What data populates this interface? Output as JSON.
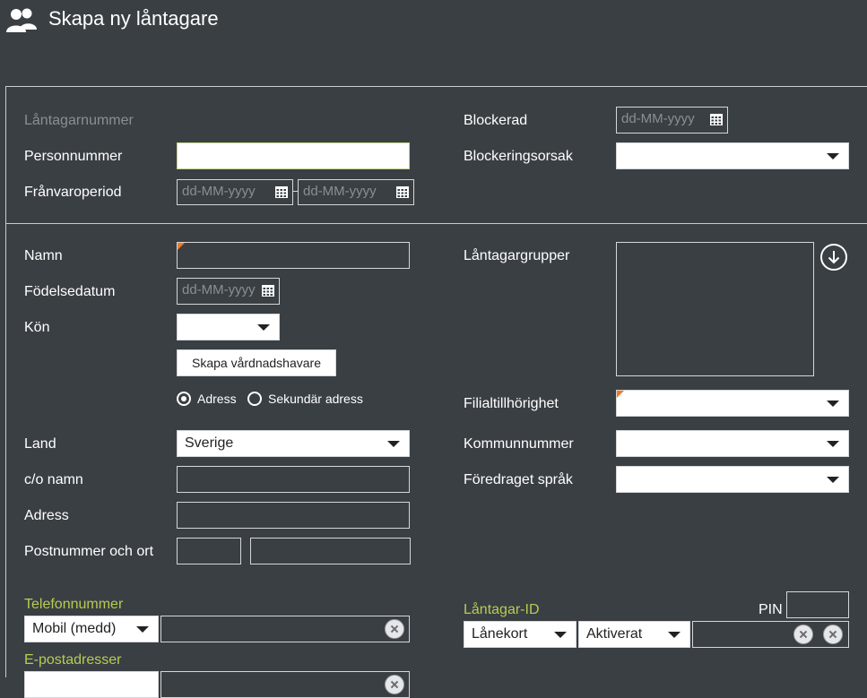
{
  "header": {
    "title": "Skapa ny låntagare"
  },
  "top": {
    "borrower_number_label": "Låntagarnummer",
    "personal_number_label": "Personnummer",
    "absence_period_label": "Frånvaroperiod",
    "absence_from_placeholder": "dd-MM-yyyy",
    "absence_to_placeholder": "dd-MM-yyyy",
    "blocked_label": "Blockerad",
    "blocked_placeholder": "dd-MM-yyyy",
    "block_reason_label": "Blockeringsorsak"
  },
  "person": {
    "name_label": "Namn",
    "birthdate_label": "Födelsedatum",
    "birthdate_placeholder": "dd-MM-yyyy",
    "gender_label": "Kön",
    "guardian_button": "Skapa vårdnadshavare",
    "address_radio": "Adress",
    "secondary_address_radio": "Sekundär adress",
    "country_label": "Land",
    "country_value": "Sverige",
    "co_name_label": "c/o namn",
    "address_label": "Adress",
    "postal_label": "Postnummer och ort",
    "borrower_groups_label": "Låntagargrupper",
    "branch_label": "Filialtillhörighet",
    "municipality_label": "Kommunnummer",
    "language_label": "Föredraget språk"
  },
  "contact": {
    "phone_label": "Telefonnummer",
    "phone_type": "Mobil (medd)",
    "email_label": "E-postadresser",
    "borrower_id_label": "Låntagar-ID",
    "pin_label": "PIN",
    "id_type": "Lånekort",
    "id_status": "Aktiverat"
  },
  "colors": {
    "background": "#3a3f44",
    "accent_green": "#b7cc52",
    "required_marker": "#f07a2a"
  }
}
